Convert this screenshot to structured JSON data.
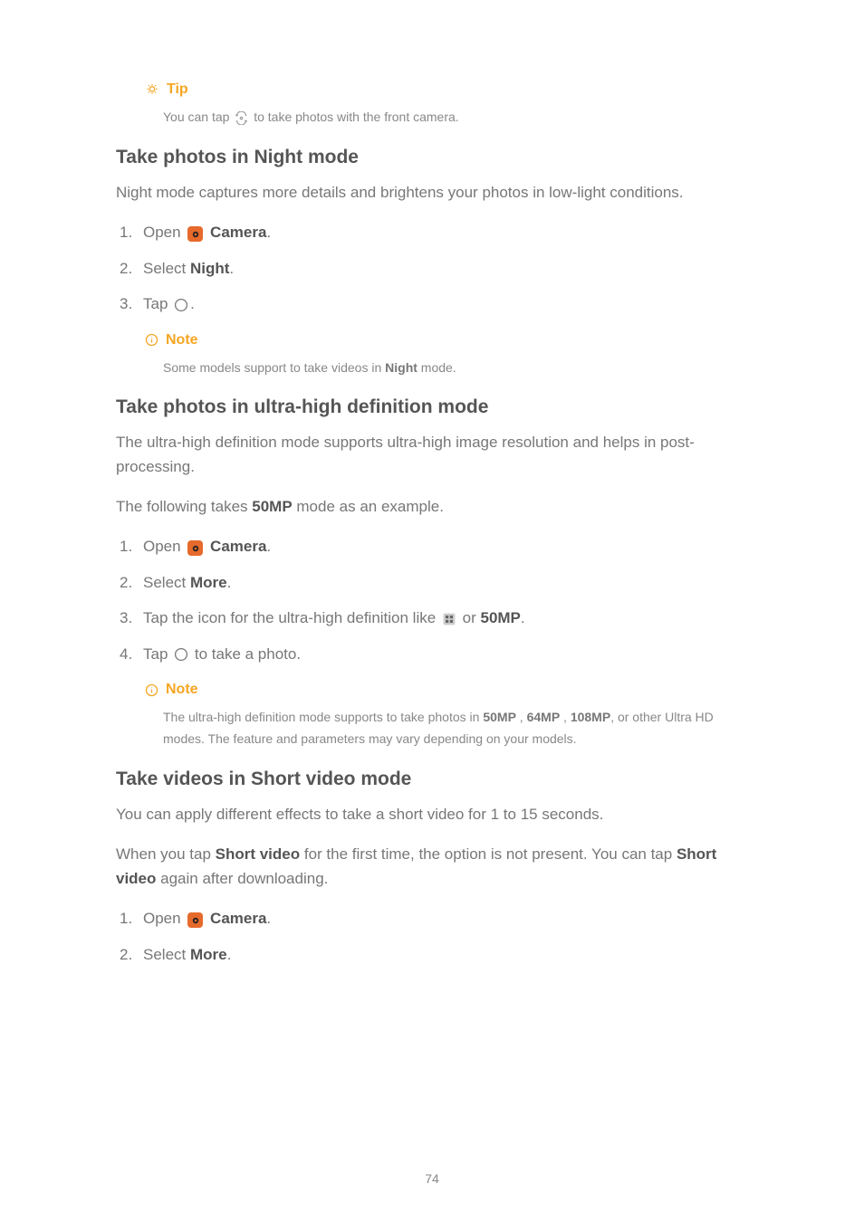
{
  "tip": {
    "label": "Tip",
    "body_pre": "You can tap ",
    "body_post": " to take photos with the front camera."
  },
  "section1": {
    "heading": "Take photos in Night mode",
    "desc": "Night mode captures more details and brightens your photos in low-light conditions.",
    "steps": {
      "s1_pre": "Open ",
      "s1_bold": "Camera",
      "s1_post": ".",
      "s2_pre": "Select ",
      "s2_bold": "Night",
      "s2_post": ".",
      "s3_pre": "Tap ",
      "s3_post": "."
    },
    "note": {
      "label": "Note",
      "pre": "Some models support to take videos in ",
      "bold": "Night",
      "post": " mode."
    }
  },
  "section2": {
    "heading": "Take photos in ultra-high definition mode",
    "desc1": "The ultra-high definition mode supports ultra-high image resolution and helps in post-processing.",
    "desc2_pre": "The following takes ",
    "desc2_bold": "50MP",
    "desc2_post": " mode as an example.",
    "steps": {
      "s1_pre": "Open ",
      "s1_bold": "Camera",
      "s1_post": ".",
      "s2_pre": "Select ",
      "s2_bold": "More",
      "s2_post": ".",
      "s3_pre": "Tap the icon for the ultra-high definition like ",
      "s3_mid": " or ",
      "s3_bold": "50MP",
      "s3_post": ".",
      "s4_pre": "Tap ",
      "s4_post": " to take a photo."
    },
    "note": {
      "label": "Note",
      "p1": "The ultra-high definition mode supports to take photos in ",
      "b1": "50MP",
      "p2": " , ",
      "b2": "64MP",
      "p3": " , ",
      "b3": "108MP",
      "p4": ", or other Ultra HD modes. The feature and parameters may vary depending on your models."
    }
  },
  "section3": {
    "heading": "Take videos in Short video mode",
    "desc1": "You can apply different effects to take a short video for 1 to 15 seconds.",
    "desc2_pre": "When you tap ",
    "desc2_b1": "Short video",
    "desc2_mid": " for the first time, the option is not present. You can tap ",
    "desc2_b2": "Short video",
    "desc2_post": " again after downloading.",
    "steps": {
      "s1_pre": "Open ",
      "s1_bold": "Camera",
      "s1_post": ".",
      "s2_pre": "Select ",
      "s2_bold": "More",
      "s2_post": "."
    }
  },
  "page_number": "74"
}
